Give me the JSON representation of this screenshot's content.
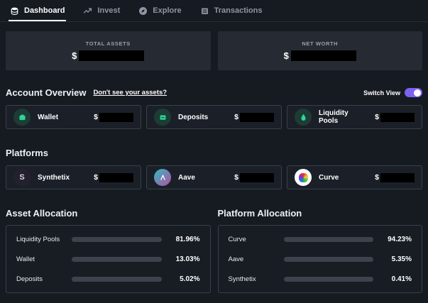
{
  "nav": {
    "tabs": [
      {
        "label": "Dashboard",
        "icon": "coins-icon",
        "active": true
      },
      {
        "label": "Invest",
        "icon": "trending-up-icon",
        "active": false
      },
      {
        "label": "Explore",
        "icon": "compass-icon",
        "active": false
      },
      {
        "label": "Transactions",
        "icon": "list-icon",
        "active": false
      }
    ]
  },
  "summary_cards": [
    {
      "label": "TOTAL ASSETS",
      "currency": "$",
      "value_redacted": true
    },
    {
      "label": "NET WORTH",
      "currency": "$",
      "value_redacted": true
    }
  ],
  "account_overview": {
    "title": "Account Overview",
    "link_label": "Don't see your assets?",
    "switch_label": "Switch View",
    "switch_state": "on",
    "accounts": [
      {
        "name": "Wallet",
        "icon": "wallet-icon",
        "currency": "$",
        "value_redacted": true
      },
      {
        "name": "Deposits",
        "icon": "deposit-box-icon",
        "currency": "$",
        "value_redacted": true
      },
      {
        "name": "Liquidity Pools",
        "icon": "droplet-icon",
        "currency": "$",
        "value_redacted": true
      }
    ]
  },
  "platforms": {
    "title": "Platforms",
    "items": [
      {
        "name": "Synthetix",
        "icon": "synthetix-logo",
        "logo_letter": "S",
        "currency": "$",
        "value_redacted": true
      },
      {
        "name": "Aave",
        "icon": "aave-logo",
        "currency": "$",
        "value_redacted": true
      },
      {
        "name": "Curve",
        "icon": "curve-logo",
        "currency": "$",
        "value_redacted": true
      }
    ]
  },
  "allocations": [
    {
      "title": "Asset Allocation",
      "rows": [
        {
          "label": "Liquidity Pools",
          "value": 81.96,
          "percent": "81.96%"
        },
        {
          "label": "Wallet",
          "value": 13.03,
          "percent": "13.03%"
        },
        {
          "label": "Deposits",
          "value": 5.02,
          "percent": "5.02%"
        }
      ]
    },
    {
      "title": "Platform Allocation",
      "rows": [
        {
          "label": "Curve",
          "value": 94.23,
          "percent": "94.23%"
        },
        {
          "label": "Aave",
          "value": 5.35,
          "percent": "5.35%"
        },
        {
          "label": "Synthetix",
          "value": 0.41,
          "percent": "0.41%"
        }
      ]
    }
  ],
  "chart_data": [
    {
      "type": "bar",
      "orientation": "horizontal",
      "title": "Asset Allocation",
      "categories": [
        "Liquidity Pools",
        "Wallet",
        "Deposits"
      ],
      "values": [
        81.96,
        13.03,
        5.02
      ],
      "unit": "%",
      "xlim": [
        0,
        100
      ],
      "bar_color": "#ffffff",
      "track_color": "#3d434c"
    },
    {
      "type": "bar",
      "orientation": "horizontal",
      "title": "Platform Allocation",
      "categories": [
        "Curve",
        "Aave",
        "Synthetix"
      ],
      "values": [
        94.23,
        5.35,
        0.41
      ],
      "unit": "%",
      "xlim": [
        0,
        100
      ],
      "bar_color": "#ffffff",
      "track_color": "#3d434c"
    }
  ],
  "colors": {
    "page_bg": "#161b21",
    "summary_card_bg": "#262b33",
    "panel_bg": "#1b2028",
    "panel_border": "#394049",
    "accent_green": "#2ed49c",
    "accent_purple": "#7d61f0",
    "bar_fill": "#ffffff",
    "bar_track": "#3d434c",
    "redaction": "#000000",
    "aave_gradient_start": "#2ebac6",
    "aave_gradient_end": "#b6509e"
  }
}
